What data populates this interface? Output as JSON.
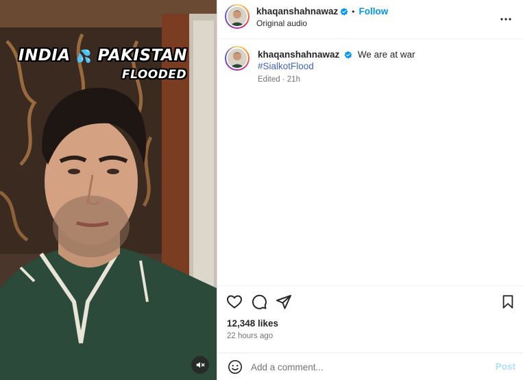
{
  "media": {
    "overlay_line1_left": "INDIA",
    "overlay_emoji": "💦",
    "overlay_line1_right": "PAKISTAN",
    "overlay_line2": "FLOODED",
    "mute_icon": "speaker-muted-icon"
  },
  "header": {
    "username": "khaqanshahnawaz",
    "separator": "•",
    "follow_label": "Follow",
    "subtitle": "Original audio",
    "more_icon": "more-horizontal-icon"
  },
  "caption": {
    "username": "khaqanshahnawaz",
    "text": "We are at war",
    "hashtag": "#SialkotFlood",
    "meta": "Edited · 21h"
  },
  "actions": {
    "icons": [
      "heart-icon",
      "comment-icon",
      "share-icon",
      "bookmark-icon"
    ],
    "likes": "12,348 likes",
    "time_ago": "22 hours ago"
  },
  "composer": {
    "placeholder": "Add a comment...",
    "post_label": "Post",
    "emoji_icon": "emoji-icon"
  },
  "colors": {
    "accent": "#0095f6",
    "hashtag": "#4263c5",
    "post_disabled": "#b2dffc",
    "shirt": "#2c4a3a"
  }
}
